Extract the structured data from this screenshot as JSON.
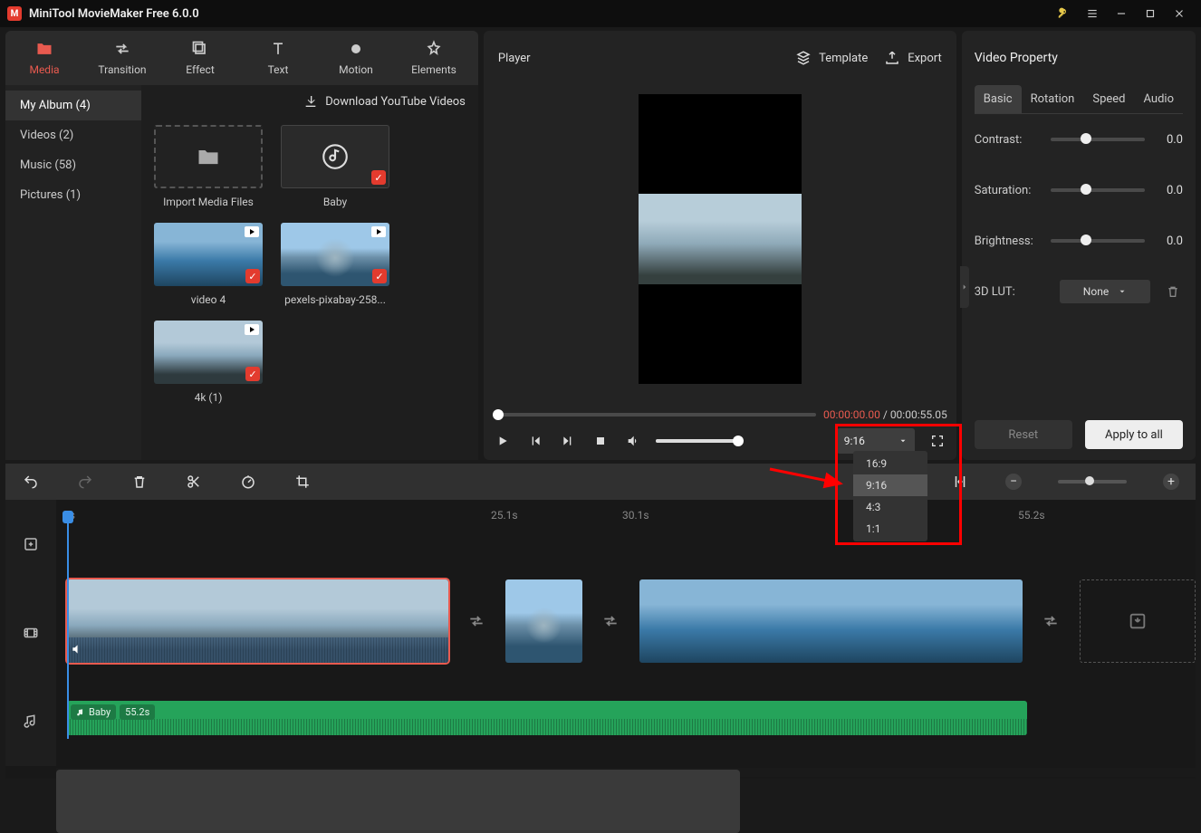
{
  "app": {
    "title": "MiniTool MovieMaker Free 6.0.0"
  },
  "tabs": [
    {
      "label": "Media",
      "active": true
    },
    {
      "label": "Transition"
    },
    {
      "label": "Effect"
    },
    {
      "label": "Text"
    },
    {
      "label": "Motion"
    },
    {
      "label": "Elements"
    }
  ],
  "sidebar": [
    {
      "label": "My Album (4)",
      "active": true
    },
    {
      "label": "Videos (2)"
    },
    {
      "label": "Music (58)"
    },
    {
      "label": "Pictures (1)"
    }
  ],
  "media_top": {
    "download": "Download YouTube Videos"
  },
  "cards": [
    {
      "label": "Import Media Files",
      "kind": "import"
    },
    {
      "label": "Baby",
      "kind": "music"
    },
    {
      "label": "video 4",
      "kind": "video",
      "look": "beach-a"
    },
    {
      "label": "pexels-pixabay-258...",
      "kind": "video",
      "look": "mountain"
    },
    {
      "label": "4k (1)",
      "kind": "video",
      "look": "waves"
    }
  ],
  "player": {
    "title": "Player",
    "template": "Template",
    "export": "Export",
    "time_cur": "00:00:00.00",
    "time_tot": "00:00:55.05",
    "ratio_selected": "9:16",
    "ratio_options": [
      "16:9",
      "9:16",
      "4:3",
      "1:1"
    ]
  },
  "properties": {
    "title": "Video Property",
    "tabs": [
      {
        "label": "Basic",
        "active": true
      },
      {
        "label": "Rotation"
      },
      {
        "label": "Speed"
      },
      {
        "label": "Audio"
      }
    ],
    "contrast": {
      "label": "Contrast:",
      "value": "0.0"
    },
    "saturation": {
      "label": "Saturation:",
      "value": "0.0"
    },
    "brightness": {
      "label": "Brightness:",
      "value": "0.0"
    },
    "lut": {
      "label": "3D LUT:",
      "value": "None"
    },
    "reset": "Reset",
    "apply": "Apply to all"
  },
  "ruler": [
    "0s",
    "25.1s",
    "30.1s",
    "55.2s"
  ],
  "audio_clip": {
    "name": "Baby",
    "dur": "55.2s"
  }
}
